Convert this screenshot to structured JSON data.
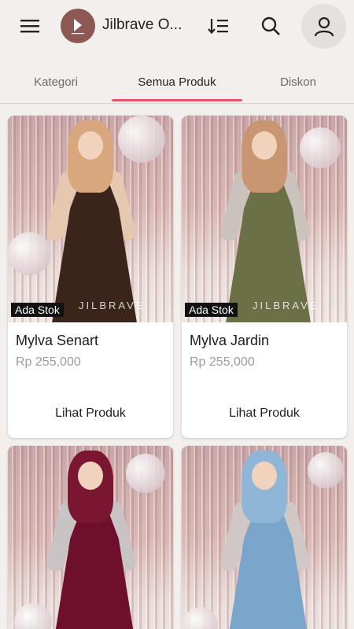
{
  "header": {
    "title": "Jilbrave O...",
    "logo_text": "JILBRAVE",
    "icons": [
      "menu-icon",
      "sort-icon",
      "search-icon",
      "account-icon"
    ]
  },
  "tabs": [
    {
      "label": "Kategori",
      "active": false
    },
    {
      "label": "Semua Produk",
      "active": true
    },
    {
      "label": "Diskon",
      "active": false
    }
  ],
  "colors": {
    "accent": "#e4566c",
    "logo_bg": "#8d5753",
    "background": "#f3efec"
  },
  "products": [
    {
      "name": "Mylva Senart",
      "price": "Rp 255,000",
      "badge": "Ada Stok",
      "cta": "Lihat Produk",
      "watermark": "JILBRAVE",
      "dress_color": "#3b2419",
      "hijab_color": "#d9a77e"
    },
    {
      "name": "Mylva Jardin",
      "price": "Rp 255,000",
      "badge": "Ada Stok",
      "cta": "Lihat Produk",
      "watermark": "JILBRAVE",
      "dress_color": "#6c7047",
      "hijab_color": "#c89671"
    },
    {
      "name": "",
      "price": "",
      "badge": "",
      "cta": "",
      "watermark": "",
      "dress_color": "#6d0f2d",
      "hijab_color": "#7a1532"
    },
    {
      "name": "",
      "price": "",
      "badge": "",
      "cta": "",
      "watermark": "",
      "dress_color": "#7aa6cb",
      "hijab_color": "#8fb6d6"
    }
  ]
}
